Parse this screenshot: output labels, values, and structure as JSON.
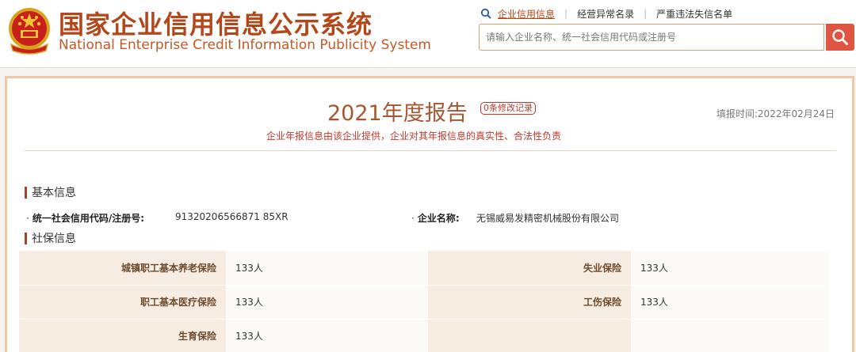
{
  "header": {
    "title_cn": "国家企业信用信息公示系统",
    "title_en": "National Enterprise Credit Information Publicity System",
    "emblem_icon": "national-emblem-icon",
    "nav": [
      {
        "label": "企业信用信息",
        "active": true
      },
      {
        "label": "经营异常名录",
        "active": false
      },
      {
        "label": "严重违法失信名单",
        "active": false
      }
    ],
    "search": {
      "placeholder": "请输入企业名称、统一社会信用代码或注册号",
      "value": ""
    }
  },
  "report": {
    "title": "2021年度报告",
    "modification_badge": "0条修改记录",
    "fill_time": "填报时间:2022年02月24日",
    "disclaimer": "企业年报信息由该企业提供，企业对其年报信息的真实性、合法性负责"
  },
  "basic_info": {
    "section_title": "基本信息",
    "credit_code_label": "统一社会信用代码/注册号:",
    "credit_code_value": "91320206566871 85XR",
    "company_name_label": "企业名称:",
    "company_name_value": "无锡威易发精密机械股份有限公司"
  },
  "social_insurance": {
    "section_title": "社保信息",
    "rows": [
      [
        {
          "label": "城镇职工基本养老保险",
          "value": "133人"
        },
        {
          "label": "失业保险",
          "value": "133人"
        }
      ],
      [
        {
          "label": "职工基本医疗保险",
          "value": "133人"
        },
        {
          "label": "工伤保险",
          "value": "133人"
        }
      ],
      [
        {
          "label": "生育保险",
          "value": "133人"
        },
        {
          "label": "",
          "value": ""
        }
      ]
    ]
  },
  "colors": {
    "brand": "#b3471a",
    "accent_red": "#c0392b",
    "search_button": "#e05541",
    "frame_border": "#efc9a4"
  }
}
